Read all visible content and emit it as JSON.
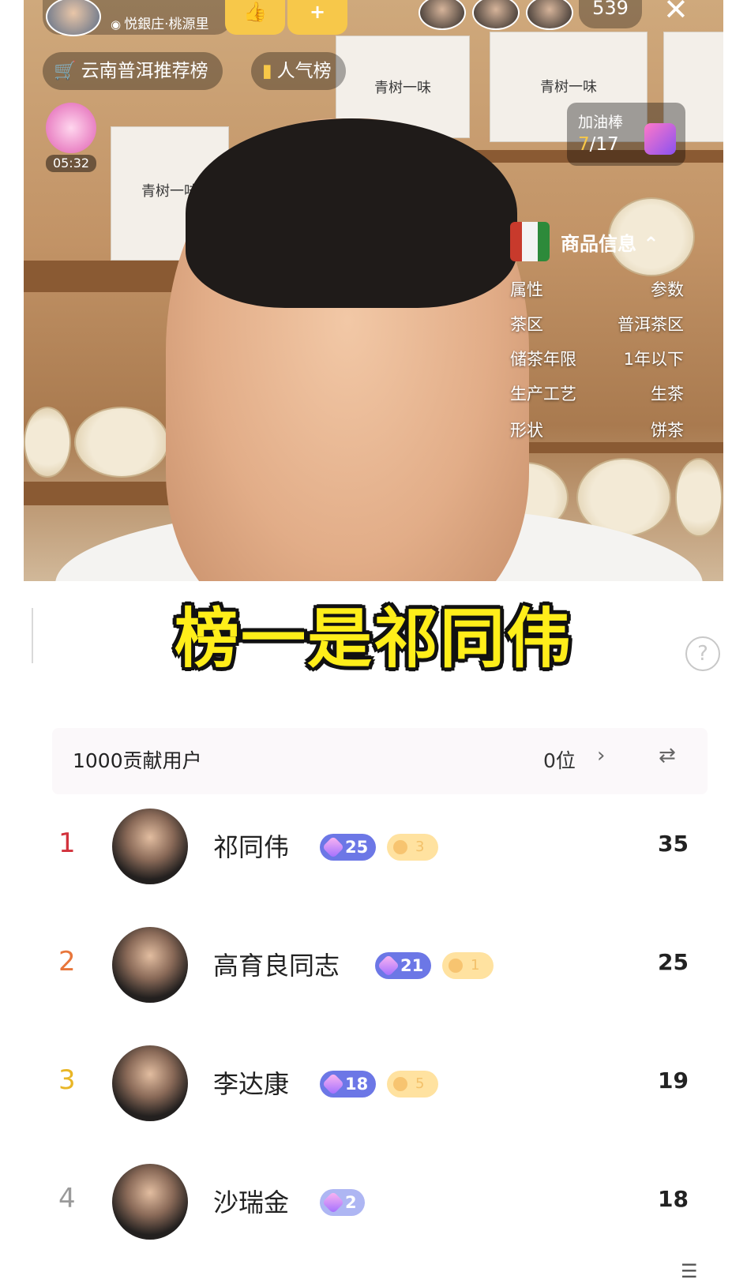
{
  "stream": {
    "host_location": "悦銀庄·桃源里",
    "viewer_count": "539",
    "chip_ranking": "云南普洱推荐榜",
    "chip_popularity": "人气榜",
    "gift_timer": "05:32",
    "boost": {
      "label": "加油棒",
      "current": "7",
      "total": "/17"
    },
    "box_text": "青树一味",
    "product": {
      "title": "商品信息",
      "header": {
        "key": "属性",
        "value": "参数"
      },
      "rows": [
        {
          "key": "茶区",
          "value": "普洱茶区"
        },
        {
          "key": "储茶年限",
          "value": "1年以下"
        },
        {
          "key": "生产工艺",
          "value": "生茶"
        },
        {
          "key": "形状",
          "value": "饼茶"
        }
      ]
    }
  },
  "caption": "榜一是祁同伟",
  "contrib": {
    "label": "1000贡献用户",
    "position": "0位"
  },
  "ranking": [
    {
      "rank": "1",
      "name": "祁同伟",
      "level": "25",
      "fan_level": "3",
      "score": "35",
      "rank_color": "#d2323c"
    },
    {
      "rank": "2",
      "name": "高育良同志",
      "level": "21",
      "fan_level": "1",
      "score": "25",
      "rank_color": "#e8763b"
    },
    {
      "rank": "3",
      "name": "李达康",
      "level": "18",
      "fan_level": "5",
      "score": "19",
      "rank_color": "#e9b626"
    },
    {
      "rank": "4",
      "name": "沙瑞金",
      "level": "2",
      "fan_level": "",
      "score": "18",
      "rank_color": "#9a9a9a"
    }
  ]
}
